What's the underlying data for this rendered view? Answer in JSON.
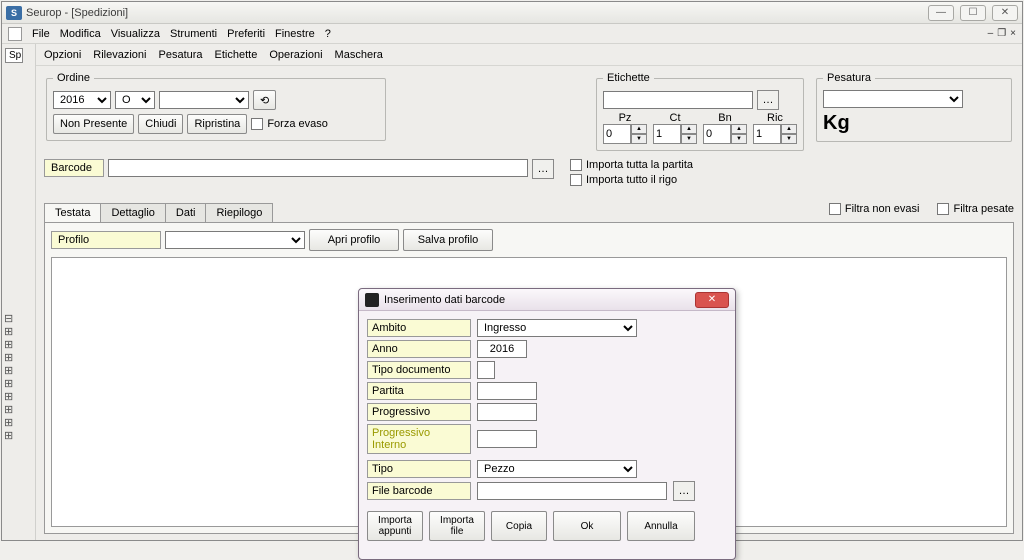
{
  "window": {
    "title": "Seurop - [Spedizioni]"
  },
  "menubar": {
    "items": [
      "File",
      "Modifica",
      "Visualizza",
      "Strumenti",
      "Preferiti",
      "Finestre",
      "?"
    ]
  },
  "leftTab": "Sp",
  "toolbar2": {
    "items": [
      "Opzioni",
      "Rilevazioni",
      "Pesatura",
      "Etichette",
      "Operazioni",
      "Maschera"
    ]
  },
  "ordine": {
    "legend": "Ordine",
    "year": "2016",
    "letter": "O",
    "nonPresente": "Non Presente",
    "chiudi": "Chiudi",
    "ripristina": "Ripristina",
    "forzaEvaso": "Forza evaso"
  },
  "etichette": {
    "legend": "Etichette",
    "cols": {
      "pz": "Pz",
      "ct": "Ct",
      "bn": "Bn",
      "ric": "Ric"
    },
    "vals": {
      "pz": "0",
      "ct": "1",
      "bn": "0",
      "ric": "1"
    }
  },
  "pesatura": {
    "legend": "Pesatura",
    "unit": "Kg"
  },
  "barcode": {
    "label": "Barcode",
    "importaPartita": "Importa tutta la partita",
    "importaRigo": "Importa tutto il rigo"
  },
  "tabs": {
    "testata": "Testata",
    "dettaglio": "Dettaglio",
    "dati": "Dati",
    "riepilogo": "Riepilogo"
  },
  "filters": {
    "nonEvasi": "Filtra non evasi",
    "pesate": "Filtra pesate"
  },
  "profilo": {
    "label": "Profilo",
    "apri": "Apri profilo",
    "salva": "Salva profilo"
  },
  "modal": {
    "title": "Inserimento dati barcode",
    "ambito": {
      "label": "Ambito",
      "value": "Ingresso"
    },
    "anno": {
      "label": "Anno",
      "value": "2016"
    },
    "tipoDoc": {
      "label": "Tipo documento"
    },
    "partita": {
      "label": "Partita"
    },
    "progressivo": {
      "label": "Progressivo"
    },
    "progInt": {
      "label": "Progressivo Interno"
    },
    "tipo": {
      "label": "Tipo",
      "value": "Pezzo"
    },
    "fileBarcode": {
      "label": "File barcode"
    },
    "buttons": {
      "importaAppunti": "Importa appunti",
      "importaFile": "Importa file",
      "copia": "Copia",
      "ok": "Ok",
      "annulla": "Annulla"
    }
  }
}
